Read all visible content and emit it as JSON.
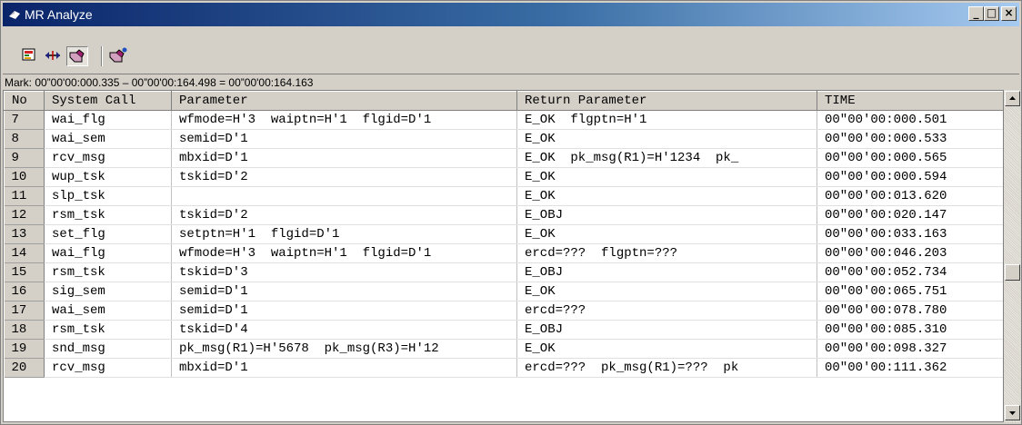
{
  "window": {
    "title": "MR Analyze",
    "controls": {
      "minimize": "_",
      "maximize": "□",
      "close": "×"
    }
  },
  "toolbar": {
    "buttons": [
      {
        "icon": "chart-view-icon",
        "pressed": false
      },
      {
        "icon": "trace-arrows-icon",
        "pressed": false
      },
      {
        "icon": "hand-pointer-icon",
        "pressed": true
      },
      {
        "icon": "hand-settings-icon",
        "pressed": false
      }
    ]
  },
  "mark": "Mark: 00”00'00:000.335 – 00”00'00:164.498 = 00”00'00:164.163",
  "table": {
    "headers": [
      "No",
      "System Call",
      "Parameter",
      "Return Parameter",
      "TIME"
    ],
    "rows": [
      [
        "7",
        "wai_flg",
        "wfmode=H'3  waiptn=H'1  flgid=D'1",
        "E_OK  flgptn=H'1",
        "00\"00'00:000.501"
      ],
      [
        "8",
        "wai_sem",
        "semid=D'1",
        "E_OK",
        "00\"00'00:000.533"
      ],
      [
        "9",
        "rcv_msg",
        "mbxid=D'1",
        "E_OK  pk_msg(R1)=H'1234  pk_",
        "00\"00'00:000.565"
      ],
      [
        "10",
        "wup_tsk",
        "tskid=D'2",
        "E_OK",
        "00\"00'00:000.594"
      ],
      [
        "11",
        "slp_tsk",
        "",
        "E_OK",
        "00\"00'00:013.620"
      ],
      [
        "12",
        "rsm_tsk",
        "tskid=D'2",
        "E_OBJ",
        "00\"00'00:020.147"
      ],
      [
        "13",
        "set_flg",
        "setptn=H'1  flgid=D'1",
        "E_OK",
        "00\"00'00:033.163"
      ],
      [
        "14",
        "wai_flg",
        "wfmode=H'3  waiptn=H'1  flgid=D'1",
        "ercd=???  flgptn=???",
        "00\"00'00:046.203"
      ],
      [
        "15",
        "rsm_tsk",
        "tskid=D'3",
        "E_OBJ",
        "00\"00'00:052.734"
      ],
      [
        "16",
        "sig_sem",
        "semid=D'1",
        "E_OK",
        "00\"00'00:065.751"
      ],
      [
        "17",
        "wai_sem",
        "semid=D'1",
        "ercd=???",
        "00\"00'00:078.780"
      ],
      [
        "18",
        "rsm_tsk",
        "tskid=D'4",
        "E_OBJ",
        "00\"00'00:085.310"
      ],
      [
        "19",
        "snd_msg",
        "pk_msg(R1)=H'5678  pk_msg(R3)=H'12",
        "E_OK",
        "00\"00'00:098.327"
      ],
      [
        "20",
        "rcv_msg",
        "mbxid=D'1",
        "ercd=???  pk_msg(R1)=???  pk",
        "00\"00'00:111.362"
      ]
    ]
  },
  "colors": {
    "title_gradient_start": "#0a246a",
    "title_gradient_end": "#a6caf0",
    "chrome": "#d4d0c8"
  }
}
